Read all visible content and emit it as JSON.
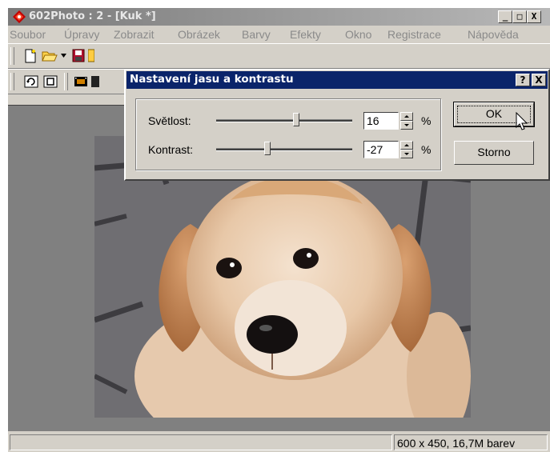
{
  "window": {
    "title": "602Photo : 2 - [Kuk *]",
    "buttons": [
      "_",
      "□",
      "X"
    ]
  },
  "menu": [
    "Soubor",
    "Úpravy",
    "Zobrazit",
    "Obrázek",
    "Barvy",
    "Efekty",
    "Okno",
    "Registrace",
    "Nápověda"
  ],
  "status": {
    "left": "",
    "info": "600 x 450, 16,7M barev"
  },
  "dialog": {
    "title": "Nastavení jasu a kontrastu",
    "help_btn": "?",
    "close_btn": "X",
    "brightness": {
      "label": "Světlost:",
      "value": "16",
      "unit": "%"
    },
    "contrast": {
      "label": "Kontrast:",
      "value": "-27",
      "unit": "%"
    },
    "ok": "OK",
    "cancel": "Storno"
  },
  "colors": {
    "titlebar_inactive": "#808080",
    "titlebar_active": "#0a246a",
    "face": "#d4d0c8",
    "workspace": "#808080"
  },
  "icons": [
    "logo-icon",
    "new-file-icon",
    "open-folder-icon",
    "save-icon",
    "rotate-icon",
    "fit-window-icon",
    "filmstrip-icon"
  ]
}
